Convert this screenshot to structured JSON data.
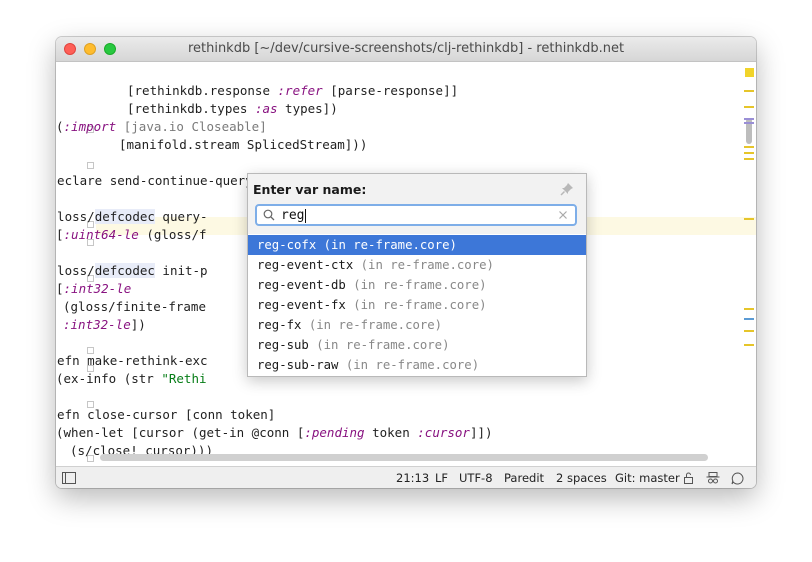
{
  "window": {
    "title": "rethinkdb [~/dev/cursive-screenshots/clj-rethinkdb] - rethinkdb.net"
  },
  "editor": {
    "lines": [
      {
        "t": 54,
        "l": 127,
        "segs": [
          [
            "[rethinkdb.response ",
            ""
          ],
          [
            ":refer",
            "kw"
          ],
          [
            " [parse-response]]",
            ""
          ]
        ]
      },
      {
        "t": 72,
        "l": 127,
        "segs": [
          [
            "[rethinkdb.types ",
            ""
          ],
          [
            ":as",
            "kw"
          ],
          [
            " types])",
            ""
          ]
        ]
      },
      {
        "t": 90,
        "l": 56,
        "segs": [
          [
            "(",
            ""
          ],
          [
            ":import",
            "kw"
          ],
          [
            " [java.io Closeable]",
            "dim"
          ]
        ]
      },
      {
        "t": 108,
        "l": 119,
        "segs": [
          [
            "[manifold.stream SplicedStream]))",
            ""
          ]
        ]
      },
      {
        "t": 144,
        "l": 42,
        "segs": [
          [
            "(declare send-continue-query send-stop-query)",
            ""
          ]
        ]
      },
      {
        "t": 180,
        "l": 42,
        "segs": [
          [
            "(gloss/",
            ""
          ],
          [
            "defcodec",
            "macro"
          ],
          [
            " query-",
            ""
          ]
        ]
      },
      {
        "t": 198,
        "l": 56,
        "segs": [
          [
            "[",
            ""
          ],
          [
            ":uint64-le",
            "kw"
          ],
          [
            " (gloss/f",
            ""
          ]
        ]
      },
      {
        "t": 234,
        "l": 42,
        "segs": [
          [
            "(gloss/",
            ""
          ],
          [
            "defcodec",
            "macro"
          ],
          [
            " init-p",
            ""
          ]
        ]
      },
      {
        "t": 252,
        "l": 56,
        "segs": [
          [
            "[",
            ""
          ],
          [
            ":int32-le",
            "kw"
          ]
        ]
      },
      {
        "t": 270,
        "l": 63,
        "segs": [
          [
            "(gloss/finite-frame",
            ""
          ]
        ]
      },
      {
        "t": 288,
        "l": 63,
        "segs": [
          [
            ":int32-le",
            "kw"
          ],
          [
            "])",
            ""
          ]
        ]
      },
      {
        "t": 324,
        "l": 42,
        "segs": [
          [
            "(defn make-rethink-exc",
            ""
          ]
        ]
      },
      {
        "t": 342,
        "l": 56,
        "segs": [
          [
            "(ex-info (str ",
            ""
          ],
          [
            "\"Rethi",
            "str"
          ]
        ]
      },
      {
        "t": 378,
        "l": 42,
        "segs": [
          [
            "(defn close-cursor [conn token]",
            ""
          ]
        ]
      },
      {
        "t": 396,
        "l": 56,
        "segs": [
          [
            "(when-let [cursor (get-in @conn [",
            ""
          ],
          [
            ":pending",
            "kw"
          ],
          [
            " token ",
            ""
          ],
          [
            ":cursor",
            "kw"
          ],
          [
            "]])",
            ""
          ]
        ]
      },
      {
        "t": 414,
        "l": 70,
        "segs": [
          [
            "(s/close! cursor)))",
            ""
          ]
        ]
      }
    ]
  },
  "popup": {
    "label": "Enter var name:",
    "query": "reg",
    "results": [
      {
        "name": "reg-cofx",
        "ns": " (in re-frame.core)"
      },
      {
        "name": "reg-event-ctx",
        "ns": " (in re-frame.core)"
      },
      {
        "name": "reg-event-db",
        "ns": " (in re-frame.core)"
      },
      {
        "name": "reg-event-fx",
        "ns": " (in re-frame.core)"
      },
      {
        "name": "reg-fx",
        "ns": " (in re-frame.core)"
      },
      {
        "name": "reg-sub",
        "ns": " (in re-frame.core)"
      },
      {
        "name": "reg-sub-raw",
        "ns": " (in re-frame.core)"
      }
    ],
    "selected_index": 0
  },
  "status": {
    "position": "21:13",
    "line_sep": "LF",
    "encoding": "UTF-8",
    "mode": "Paredit",
    "indent": "2 spaces",
    "vcs": "Git: master"
  },
  "colors": {
    "selection": "#3d77d8",
    "keyword": "#881280",
    "string": "#067d17"
  }
}
